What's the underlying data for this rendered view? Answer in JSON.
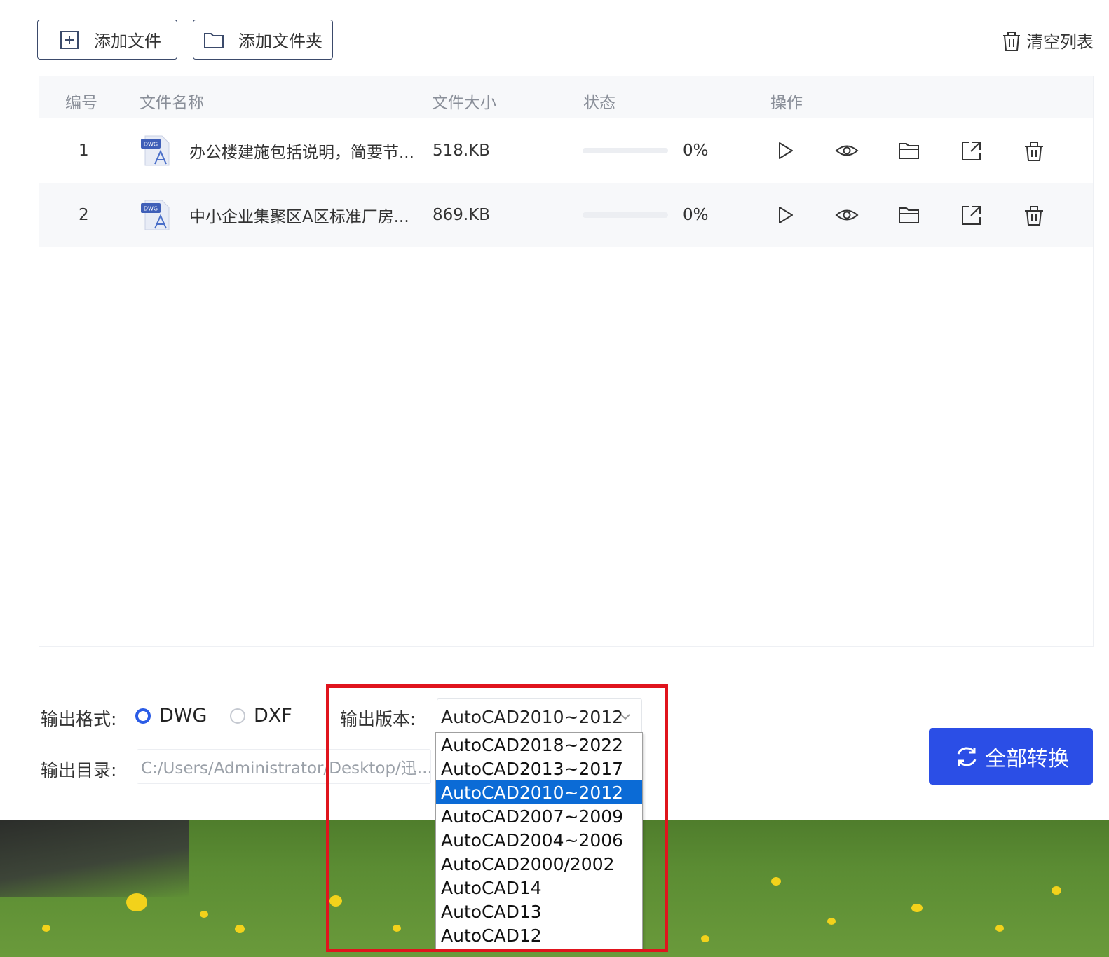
{
  "toolbar": {
    "add_file_label": "添加文件",
    "add_folder_label": "添加文件夹",
    "clear_list_label": "清空列表"
  },
  "table": {
    "headers": {
      "number": "编号",
      "file_name": "文件名称",
      "file_size": "文件大小",
      "status": "状态",
      "actions": "操作"
    },
    "rows": [
      {
        "number": "1",
        "file_type": "DWG",
        "name": "办公楼建施包括说明，简要节...",
        "size": "518.KB",
        "progress": "0%"
      },
      {
        "number": "2",
        "file_type": "DWG",
        "name": "中小企业集聚区A区标准厂房...",
        "size": "869.KB",
        "progress": "0%"
      }
    ],
    "row_action_icons": [
      "play-icon",
      "eye-icon",
      "folder-open-icon",
      "share-icon",
      "trash-icon"
    ]
  },
  "settings": {
    "format_label": "输出格式:",
    "format_options": [
      "DWG",
      "DXF"
    ],
    "format_selected": "DWG",
    "version_label": "输出版本:",
    "version_selected": "AutoCAD2010~2012",
    "version_options": [
      "AutoCAD2018~2022",
      "AutoCAD2013~2017",
      "AutoCAD2010~2012",
      "AutoCAD2007~2009",
      "AutoCAD2004~2006",
      "AutoCAD2000/2002",
      "AutoCAD14",
      "AutoCAD13",
      "AutoCAD12"
    ],
    "dir_label": "输出目录:",
    "dir_value": "C:/Users/Administrator/Desktop/迅...",
    "convert_label": "全部转换"
  },
  "colors": {
    "accent": "#2b4ee6",
    "selection": "#0b6bd6",
    "highlight_box": "#e0141d"
  }
}
